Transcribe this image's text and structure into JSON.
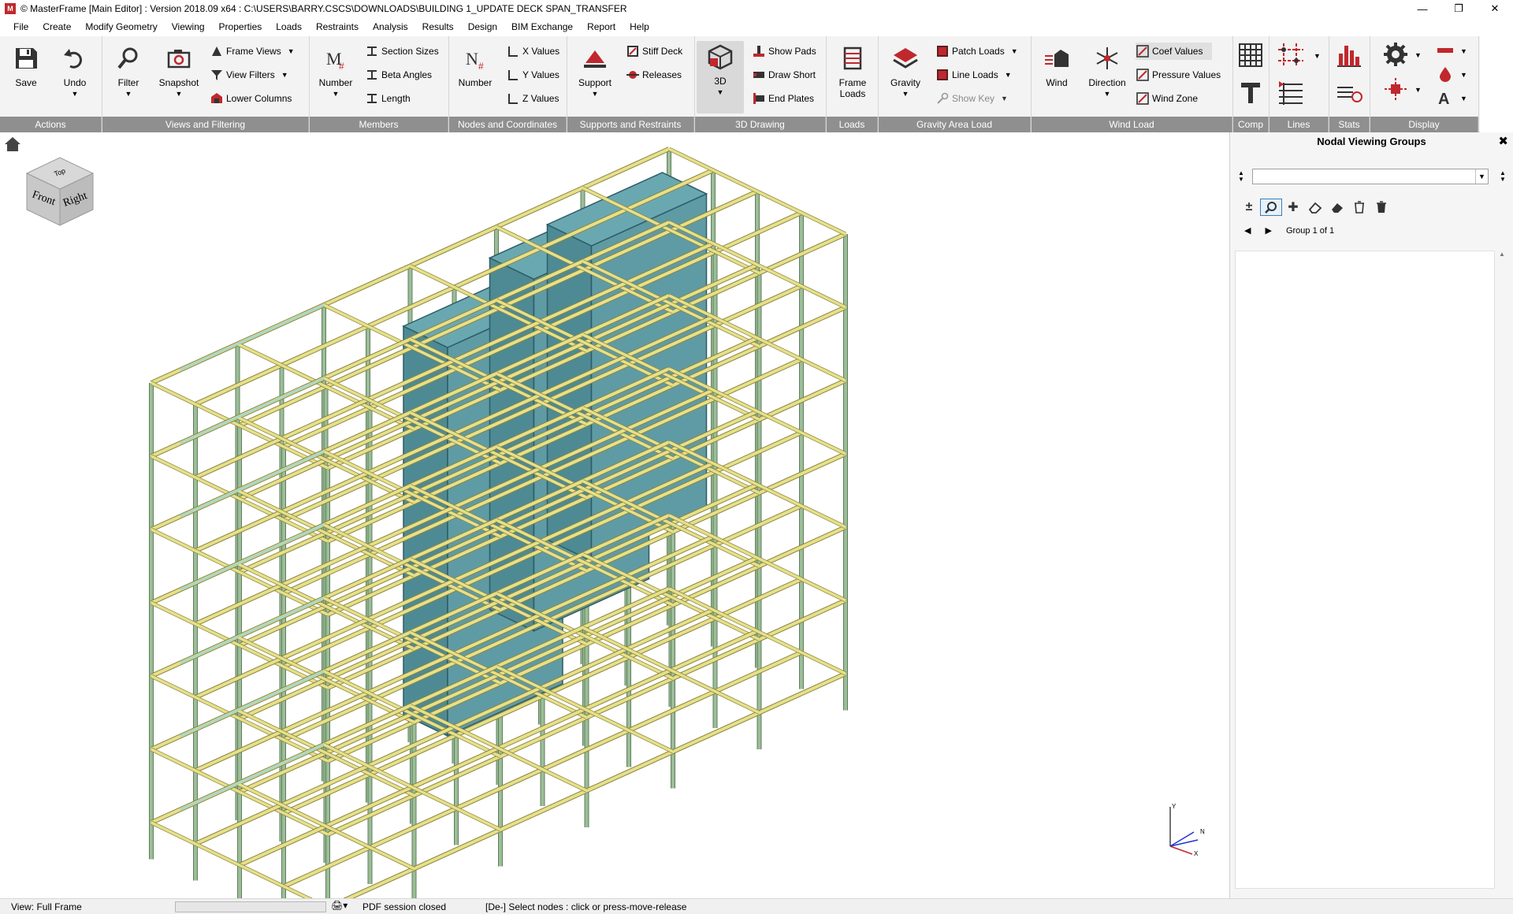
{
  "window": {
    "title": "© MasterFrame [Main Editor] : Version 2018.09 x64 : C:\\USERS\\BARRY.CSCS\\DOWNLOADS\\BUILDING 1_UPDATE DECK SPAN_TRANSFER",
    "minimize": "—",
    "restore": "❐",
    "close": "✕"
  },
  "menu": [
    "File",
    "Create",
    "Modify Geometry",
    "Viewing",
    "Properties",
    "Loads",
    "Restraints",
    "Analysis",
    "Results",
    "Design",
    "BIM Exchange",
    "Report",
    "Help"
  ],
  "ribbon": {
    "actions": {
      "label": "Actions",
      "save": "Save",
      "undo": "Undo"
    },
    "views": {
      "label": "Views and Filtering",
      "filter": "Filter",
      "snapshot": "Snapshot",
      "frame_views": "Frame Views",
      "view_filters": "View Filters",
      "lower_columns": "Lower Columns"
    },
    "members": {
      "label": "Members",
      "number": "Number",
      "section_sizes": "Section Sizes",
      "beta_angles": "Beta Angles",
      "length": "Length"
    },
    "nodes": {
      "label": "Nodes and Coordinates",
      "number": "Number",
      "x_values": "X Values",
      "y_values": "Y Values",
      "z_values": "Z Values"
    },
    "supports": {
      "label": "Supports and Restraints",
      "support": "Support",
      "stiff_deck": "Stiff Deck",
      "releases": "Releases"
    },
    "drawing3d": {
      "label": "3D Drawing",
      "threed": "3D",
      "show_pads": "Show Pads",
      "draw_short": "Draw Short",
      "end_plates": "End Plates"
    },
    "loads": {
      "label": "Loads",
      "frame_loads_1": "Frame",
      "frame_loads_2": "Loads"
    },
    "gravity": {
      "label": "Gravity Area Load",
      "gravity": "Gravity",
      "patch_loads": "Patch Loads",
      "line_loads": "Line Loads",
      "show_key": "Show Key"
    },
    "wind": {
      "label": "Wind Load",
      "wind": "Wind",
      "direction": "Direction",
      "coef_values": "Coef Values",
      "pressure_values": "Pressure Values",
      "wind_zone": "Wind Zone"
    },
    "comp": {
      "label": "Comp"
    },
    "lines": {
      "label": "Lines"
    },
    "stats": {
      "label": "Stats"
    },
    "display": {
      "label": "Display"
    }
  },
  "viewcube": {
    "top": "Top",
    "front": "Front",
    "right": "Right"
  },
  "axes": {
    "y": "Y",
    "n": "N",
    "x": "X"
  },
  "panel": {
    "title": "Nodal Viewing Groups",
    "group_nav": "Group 1 of 1",
    "combo_value": ""
  },
  "status": {
    "view": "View: Full Frame",
    "pdf": "PDF session closed",
    "hint": "[De-] Select nodes : click or press-move-release"
  },
  "colors": {
    "beam": "#e6e08a",
    "beam_edge": "#8a8440",
    "column": "#9cbd98",
    "column_edge": "#5e7f5c",
    "core": "#4e8a93",
    "core_edge": "#2d5d66",
    "bracing": "#a8d8c8",
    "accent": "#c0282d"
  }
}
